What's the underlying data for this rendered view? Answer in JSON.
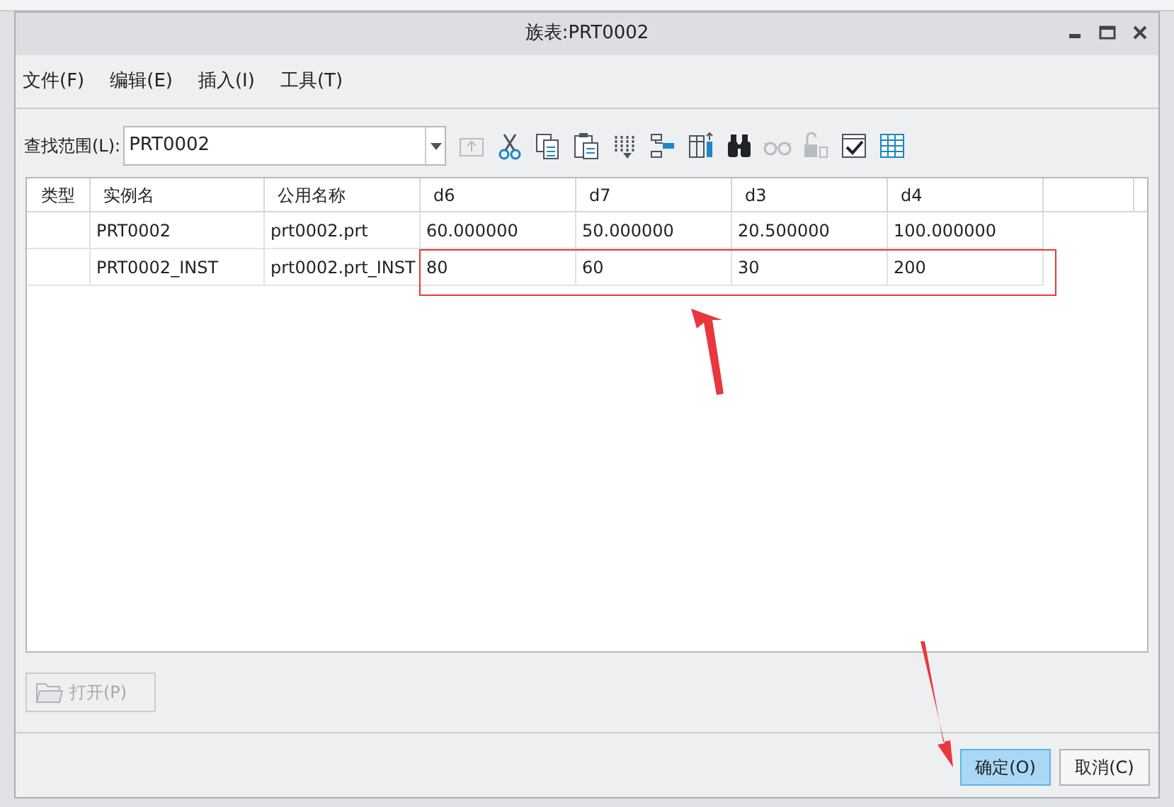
{
  "window": {
    "title": "族表:PRT0002"
  },
  "menu": [
    "文件(F)",
    "编辑(E)",
    "插入(I)",
    "工具(T)"
  ],
  "search": {
    "label": "查找范围(L):",
    "value": "PRT0002"
  },
  "toolbar": [
    {
      "kind": "up",
      "disabled": true
    },
    {
      "kind": "cut",
      "disabled": false
    },
    {
      "kind": "copy",
      "disabled": false
    },
    {
      "kind": "paste",
      "disabled": false
    },
    {
      "kind": "sort",
      "disabled": false
    },
    {
      "kind": "tree",
      "disabled": false
    },
    {
      "kind": "insert-column",
      "disabled": false
    },
    {
      "kind": "find",
      "disabled": false
    },
    {
      "kind": "glasses",
      "disabled": true
    },
    {
      "kind": "lock",
      "disabled": true
    },
    {
      "kind": "check",
      "disabled": false
    },
    {
      "kind": "table",
      "disabled": false
    }
  ],
  "table": {
    "columns": [
      "类型",
      "实例名",
      "公用名称",
      "d6",
      "d7",
      "d3",
      "d4"
    ],
    "rows": [
      [
        "",
        "PRT0002",
        "prt0002.prt",
        "60.000000",
        "50.000000",
        "20.500000",
        "100.000000"
      ],
      [
        "",
        "PRT0002_INST",
        "prt0002.prt_INST",
        "80",
        "60",
        "30",
        "200"
      ]
    ]
  },
  "open_button": {
    "label": "打开(P)",
    "disabled": true
  },
  "buttons": [
    {
      "label": "确定(O)",
      "selected": true
    },
    {
      "label": "取消(C)",
      "selected": false
    }
  ]
}
